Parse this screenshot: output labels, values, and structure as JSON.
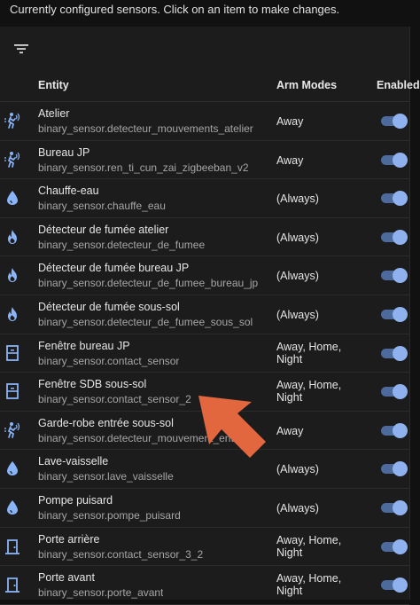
{
  "header_text": "Currently configured sensors. Click on an item to make changes.",
  "columns": {
    "entity": "Entity",
    "arm_modes": "Arm Modes",
    "enabled": "Enabled"
  },
  "colors": {
    "icon": "#8ab4f8",
    "toggle_track": "#4c6a9c",
    "toggle_knob": "#8fb2ef",
    "arrow": "#e2673f"
  },
  "rows": [
    {
      "name": "Atelier",
      "entity": "binary_sensor.detecteur_mouvements_atelier",
      "modes": [
        "Away"
      ],
      "icon": "motion-sensor-icon",
      "enabled": true
    },
    {
      "name": "Bureau JP",
      "entity": "binary_sensor.ren_ti_cun_zai_zigbeeban_v2",
      "modes": [
        "Away"
      ],
      "icon": "motion-sensor-icon",
      "enabled": true
    },
    {
      "name": "Chauffe-eau",
      "entity": "binary_sensor.chauffe_eau",
      "modes": [
        "(Always)"
      ],
      "icon": "water-drop-icon",
      "enabled": true
    },
    {
      "name": "Détecteur de fumée atelier",
      "entity": "binary_sensor.detecteur_de_fumee",
      "modes": [
        "(Always)"
      ],
      "icon": "fire-icon",
      "enabled": true
    },
    {
      "name": "Détecteur de fumée bureau JP",
      "entity": "binary_sensor.detecteur_de_fumee_bureau_jp",
      "modes": [
        "(Always)"
      ],
      "icon": "fire-icon",
      "enabled": true
    },
    {
      "name": "Détecteur de fumée sous-sol",
      "entity": "binary_sensor.detecteur_de_fumee_sous_sol",
      "modes": [
        "(Always)"
      ],
      "icon": "fire-icon",
      "enabled": true
    },
    {
      "name": "Fenêtre bureau JP",
      "entity": "binary_sensor.contact_sensor",
      "modes": [
        "Away, Home,",
        "Night"
      ],
      "icon": "window-icon",
      "enabled": true
    },
    {
      "name": "Fenêtre SDB sous-sol",
      "entity": "binary_sensor.contact_sensor_2",
      "modes": [
        "Away, Home,",
        "Night"
      ],
      "icon": "window-icon",
      "enabled": true
    },
    {
      "name": "Garde-robe entrée sous-sol",
      "entity": "binary_sensor.detecteur_mouvement_ent",
      "modes": [
        "Away"
      ],
      "icon": "motion-sensor-icon",
      "enabled": true
    },
    {
      "name": "Lave-vaisselle",
      "entity": "binary_sensor.lave_vaisselle",
      "modes": [
        "(Always)"
      ],
      "icon": "water-drop-icon",
      "enabled": true
    },
    {
      "name": "Pompe puisard",
      "entity": "binary_sensor.pompe_puisard",
      "modes": [
        "(Always)"
      ],
      "icon": "water-drop-icon",
      "enabled": true
    },
    {
      "name": "Porte arrière",
      "entity": "binary_sensor.contact_sensor_3_2",
      "modes": [
        "Away, Home,",
        "Night"
      ],
      "icon": "door-icon",
      "enabled": true
    },
    {
      "name": "Porte avant",
      "entity": "binary_sensor.porte_avant",
      "modes": [
        "Away, Home,",
        "Night"
      ],
      "icon": "door-icon",
      "enabled": true
    }
  ]
}
